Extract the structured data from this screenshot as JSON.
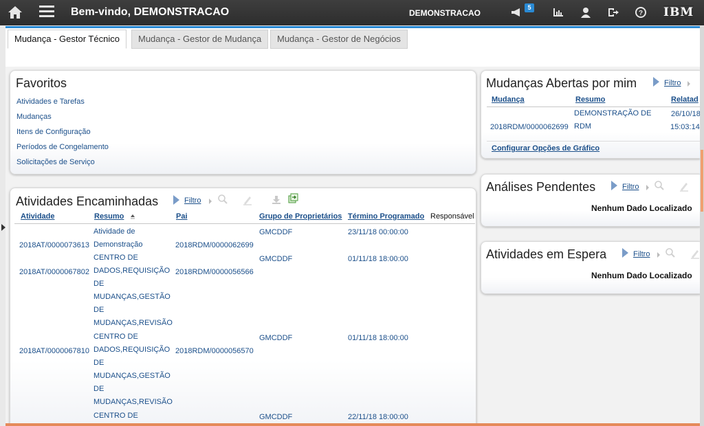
{
  "header": {
    "welcome": "Bem-vindo, DEMONSTRACAO",
    "user": "DEMONSTRACAO",
    "notification_count": "5",
    "logo": "IBM",
    "icons": [
      "home-icon",
      "menu-icon",
      "megaphone-icon",
      "bar-chart-icon",
      "person-icon",
      "logout-icon",
      "help-icon"
    ]
  },
  "tabs": [
    {
      "label": "Mudança - Gestor Técnico",
      "active": true
    },
    {
      "label": "Mudança - Gestor de Mudança",
      "active": false
    },
    {
      "label": "Mudança - Gestor de Negócios",
      "active": false
    }
  ],
  "favorites": {
    "title": "Favoritos",
    "links": [
      "Atividades e Tarefas",
      "Mudanças",
      "Itens de Configuração",
      "Períodos de Congelamento",
      "Solicitações de Serviço"
    ]
  },
  "activities": {
    "title": "Atividades Encaminhadas",
    "filter": "Filtro",
    "columns": [
      "Atividade",
      "Resumo",
      "Pai",
      "Grupo de Proprietários",
      "Término Programado",
      "Responsável"
    ],
    "rows": [
      {
        "atividade": "2018AT/0000073613",
        "resumo": "Atividade de Demonstração",
        "pai": "2018RDM/0000062699",
        "grupo": "GMCDDF",
        "termino": "23/11/18 00:00:00"
      },
      {
        "atividade": "2018AT/0000067802",
        "resumo": "CENTRO DE DADOS,REQUISIÇÃO DE MUDANÇAS,GESTÃO DE MUDANÇAS,REVISÃO",
        "pai": "2018RDM/0000056566",
        "grupo": "GMCDDF",
        "termino": "01/11/18 18:00:00"
      },
      {
        "atividade": "2018AT/0000067810",
        "resumo": "CENTRO DE DADOS,REQUISIÇÃO DE MUDANÇAS,GESTÃO DE MUDANÇAS,REVISÃO",
        "pai": "2018RDM/0000056570",
        "grupo": "GMCDDF",
        "termino": "01/11/18 18:00:00"
      },
      {
        "atividade": "",
        "resumo": "CENTRO DE",
        "pai": "",
        "grupo": "GMCDDF",
        "termino": "22/11/18 18:00:00"
      }
    ]
  },
  "open_changes": {
    "title": "Mudanças Abertas por mim",
    "filter": "Filtro",
    "columns": [
      "Mudança",
      "Resumo",
      "Relatad"
    ],
    "rows": [
      {
        "mudanca": "2018RDM/0000062699",
        "resumo": "DEMONSTRAÇÃO DE RDM",
        "data": "26/10/18",
        "hora": "15:03:14"
      }
    ],
    "configure": "Configurar Opções de Gráfico"
  },
  "pending": {
    "title": "Análises Pendentes",
    "filter": "Filtro",
    "nodata": "Nenhum Dado Localizado"
  },
  "waiting": {
    "title": "Atividades em Espera",
    "filter": "Filtro",
    "nodata": "Nenhum Dado Localizado"
  }
}
